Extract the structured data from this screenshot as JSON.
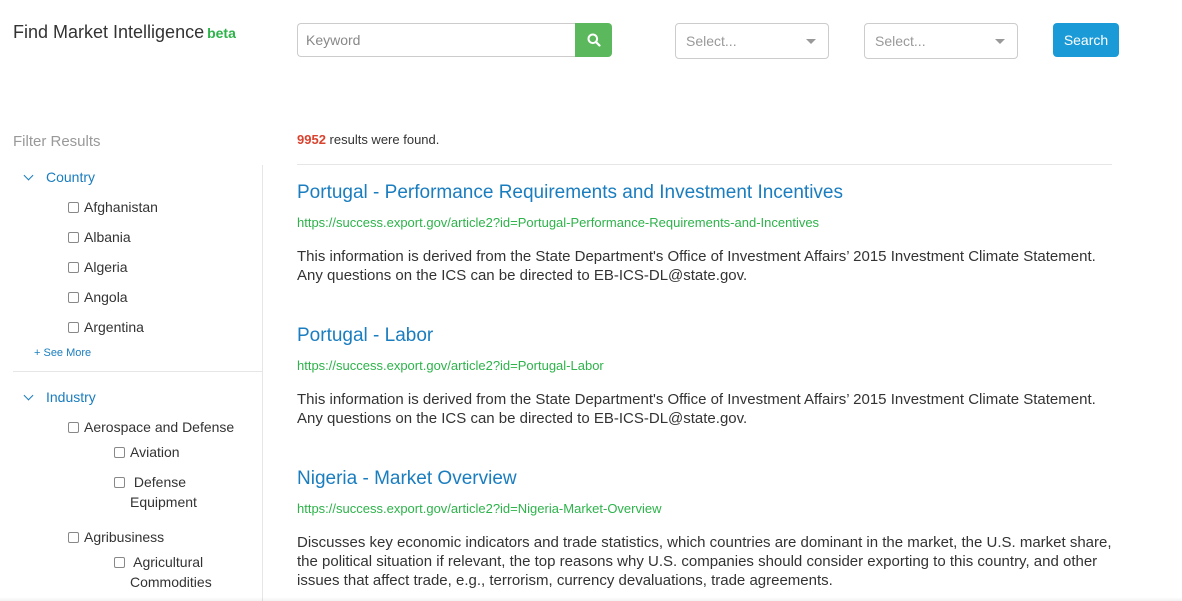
{
  "header": {
    "title": "Find Market Intelligence",
    "beta": "beta",
    "search_placeholder": "Keyword",
    "select1_placeholder": "Select...",
    "select2_placeholder": "Select...",
    "search_button": "Search"
  },
  "sidebar": {
    "filter_title": "Filter Results",
    "country": {
      "label": "Country",
      "items": [
        "Afghanistan",
        "Albania",
        "Algeria",
        "Angola",
        "Argentina"
      ],
      "see_more": "+ See More"
    },
    "industry": {
      "label": "Industry",
      "items": [
        {
          "label": "Aerospace and Defense",
          "children": [
            "Aviation",
            "Defense Equipment"
          ]
        },
        {
          "label": "Agribusiness",
          "children": [
            "Agricultural Commodities"
          ]
        }
      ]
    }
  },
  "results": {
    "count": "9952",
    "count_suffix": " results were found.",
    "items": [
      {
        "title": "Portugal - Performance Requirements and Investment Incentives",
        "url": "https://success.export.gov/article2?id=Portugal-Performance-Requirements-and-Incentives",
        "desc": "This information is derived from the State Department's Office of Investment Affairs’ 2015 Investment Climate Statement. Any questions on the ICS can be directed to EB-ICS-DL@state.gov."
      },
      {
        "title": "Portugal - Labor",
        "url": "https://success.export.gov/article2?id=Portugal-Labor",
        "desc": "This information is derived from the State Department's Office of Investment Affairs’ 2015 Investment Climate Statement. Any questions on the ICS can be directed to EB-ICS-DL@state.gov."
      },
      {
        "title": "Nigeria - Market Overview",
        "url": "https://success.export.gov/article2?id=Nigeria-Market-Overview",
        "desc": "Discusses key economic indicators and trade statistics, which countries are dominant in the market, the U.S. market share, the political situation if relevant, the top reasons why U.S. companies should consider exporting to this country, and other issues that affect trade, e.g., terrorism, currency devaluations, trade agreements."
      }
    ]
  },
  "colors": {
    "link": "#1a7dbf",
    "url_green": "#2db34a",
    "search_green": "#5cb85c",
    "primary_button": "#1a9bd7",
    "count_red": "#d9432f"
  },
  "icons": {
    "search": "search-icon",
    "expand": "chevron-down-icon",
    "dropdown": "caret-down-icon"
  }
}
